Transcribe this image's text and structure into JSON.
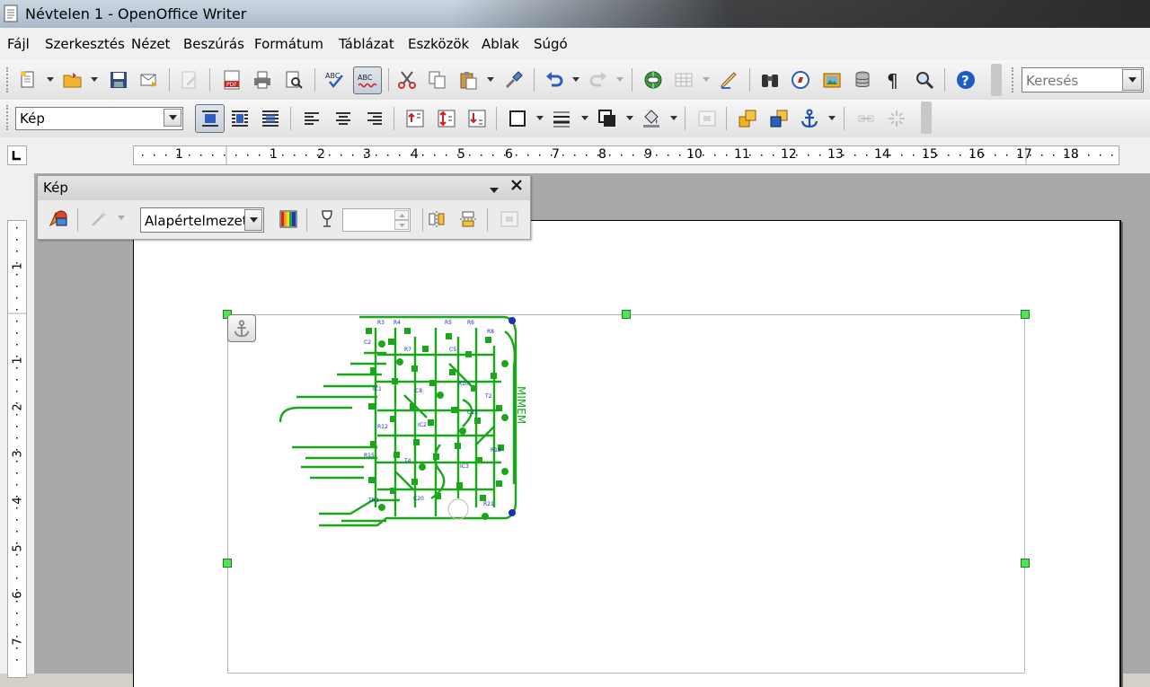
{
  "window": {
    "title": "Névtelen 1 - OpenOffice Writer"
  },
  "menu": [
    "Fájl",
    "Szerkesztés",
    "Nézet",
    "Beszúrás",
    "Formátum",
    "Táblázat",
    "Eszközök",
    "Ablak",
    "Súgó"
  ],
  "toolbar": {
    "search_placeholder": "Keresés",
    "frame_style": "Kép"
  },
  "ruler": {
    "h_numbers": [
      "1",
      "1",
      "2",
      "3",
      "4",
      "5",
      "6",
      "7",
      "8",
      "9",
      "10",
      "11",
      "12",
      "13",
      "14",
      "15",
      "16",
      "17",
      "18"
    ],
    "v_numbers": [
      "1",
      "1",
      "2",
      "3",
      "4",
      "5",
      "6",
      "7"
    ]
  },
  "image_toolbar": {
    "title": "Kép",
    "graphics_mode": "Alapértelmezett"
  },
  "colors": {
    "handle": "#4ee64e",
    "pcb_trace": "#1aa81a",
    "pcb_label": "#1c2fb8"
  }
}
